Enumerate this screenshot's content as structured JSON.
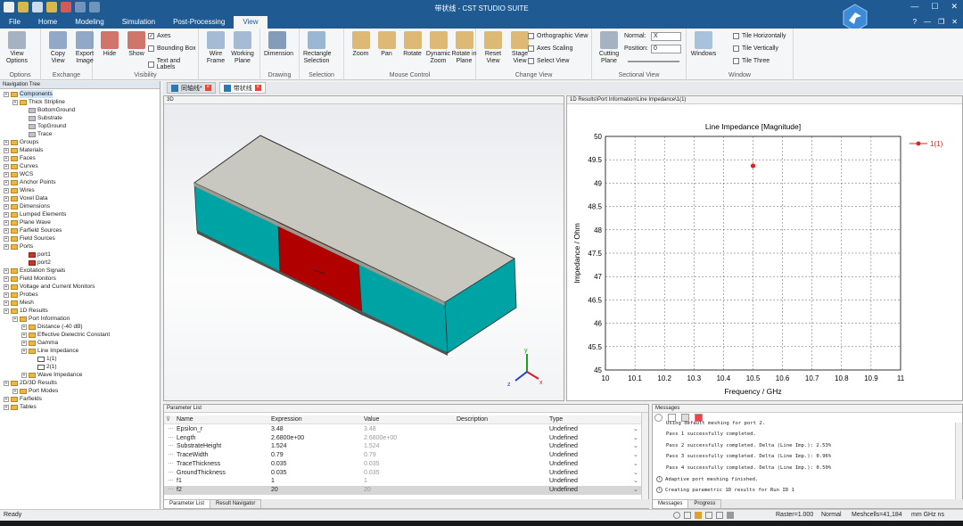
{
  "window": {
    "title": "带状线 - CST STUDIO SUITE"
  },
  "menu": {
    "tabs": [
      "File",
      "Home",
      "Modeling",
      "Simulation",
      "Post-Processing",
      "View"
    ],
    "active": "View"
  },
  "ribbon": {
    "groups": [
      {
        "label": "Options",
        "buttons": [
          "View\nOptions"
        ]
      },
      {
        "label": "Exchange",
        "buttons": [
          "Copy\nView",
          "Export\nImage"
        ]
      },
      {
        "label": "Visibility",
        "buttons": [
          "Hide",
          "Show"
        ],
        "checks": [
          "Axes",
          "Bounding Box",
          "Text and Labels"
        ]
      },
      {
        "label": "",
        "buttons": [
          "Wire\nFrame",
          "Working\nPlane"
        ]
      },
      {
        "label": "Drawing",
        "buttons": [
          "Dimension"
        ]
      },
      {
        "label": "Selection",
        "buttons": [
          "Rectangle\nSelection"
        ]
      },
      {
        "label": "Mouse Control",
        "buttons": [
          "Zoom",
          "Pan",
          "Rotate",
          "Dynamic\nZoom",
          "Rotate in\nPlane"
        ]
      },
      {
        "label": "Change View",
        "buttons": [
          "Reset\nView",
          "Stage\nView"
        ],
        "checks": [
          "Orthographic View",
          "Axes Scaling",
          "Select View"
        ]
      },
      {
        "label": "Sectional View",
        "buttons": [
          "Cutting\nPlane"
        ],
        "fields": {
          "normal_label": "Normal:",
          "normal_value": "X",
          "position_label": "Position:",
          "position_value": "0"
        }
      },
      {
        "label": "Window",
        "buttons": [
          "Windows"
        ],
        "checks": [
          "Tile Horizontally",
          "Tile Vertically",
          "Tile Three"
        ]
      }
    ]
  },
  "nav": {
    "header": "Navigation Tree",
    "items": [
      {
        "label": "Components",
        "level": 0,
        "icon": "folder",
        "selected": true
      },
      {
        "label": "Thick Stripline",
        "level": 1,
        "icon": "folder"
      },
      {
        "label": "BottomGround",
        "level": 2,
        "icon": "solid"
      },
      {
        "label": "Substrate",
        "level": 2,
        "icon": "solid"
      },
      {
        "label": "TopGround",
        "level": 2,
        "icon": "solid"
      },
      {
        "label": "Trace",
        "level": 2,
        "icon": "solid"
      },
      {
        "label": "Groups",
        "level": 0,
        "icon": "folder"
      },
      {
        "label": "Materials",
        "level": 0,
        "icon": "folder"
      },
      {
        "label": "Faces",
        "level": 0,
        "icon": "folder"
      },
      {
        "label": "Curves",
        "level": 0,
        "icon": "folder"
      },
      {
        "label": "WCS",
        "level": 0,
        "icon": "folder"
      },
      {
        "label": "Anchor Points",
        "level": 0,
        "icon": "folder"
      },
      {
        "label": "Wires",
        "level": 0,
        "icon": "folder"
      },
      {
        "label": "Voxel Data",
        "level": 0,
        "icon": "folder"
      },
      {
        "label": "Dimensions",
        "level": 0,
        "icon": "folder"
      },
      {
        "label": "Lumped Elements",
        "level": 0,
        "icon": "folder"
      },
      {
        "label": "Plane Wave",
        "level": 0,
        "icon": "folder"
      },
      {
        "label": "Farfield Sources",
        "level": 0,
        "icon": "folder"
      },
      {
        "label": "Field Sources",
        "level": 0,
        "icon": "folder"
      },
      {
        "label": "Ports",
        "level": 0,
        "icon": "folder"
      },
      {
        "label": "port1",
        "level": 2,
        "icon": "port"
      },
      {
        "label": "port2",
        "level": 2,
        "icon": "port"
      },
      {
        "label": "Excitation Signals",
        "level": 0,
        "icon": "folder"
      },
      {
        "label": "Field Monitors",
        "level": 0,
        "icon": "folder"
      },
      {
        "label": "Voltage and Current Monitors",
        "level": 0,
        "icon": "folder"
      },
      {
        "label": "Probes",
        "level": 0,
        "icon": "folder"
      },
      {
        "label": "Mesh",
        "level": 0,
        "icon": "folder"
      },
      {
        "label": "1D Results",
        "level": 0,
        "icon": "folder"
      },
      {
        "label": "Port Information",
        "level": 1,
        "icon": "folder"
      },
      {
        "label": "Distance (-40 dB)",
        "level": 2,
        "icon": "folder"
      },
      {
        "label": "Effective Dielectric Constant",
        "level": 2,
        "icon": "folder"
      },
      {
        "label": "Gamma",
        "level": 2,
        "icon": "folder"
      },
      {
        "label": "Line Impedance",
        "level": 2,
        "icon": "folder"
      },
      {
        "label": "1(1)",
        "level": 3,
        "icon": "plot"
      },
      {
        "label": "2(1)",
        "level": 3,
        "icon": "plot"
      },
      {
        "label": "Wave Impedance",
        "level": 2,
        "icon": "folder"
      },
      {
        "label": "2D/3D Results",
        "level": 0,
        "icon": "folder"
      },
      {
        "label": "Port Modes",
        "level": 1,
        "icon": "folder"
      },
      {
        "label": "Farfields",
        "level": 0,
        "icon": "folder"
      },
      {
        "label": "Tables",
        "level": 0,
        "icon": "folder"
      }
    ]
  },
  "doctabs": [
    "同轴线*",
    "带状线"
  ],
  "view3d": {
    "header": "3D",
    "axis_labels": [
      "x",
      "y",
      "z"
    ]
  },
  "plot": {
    "header": "1D Results\\Port Information\\Line Impedance\\1(1)"
  },
  "chart_data": {
    "type": "scatter",
    "title": "Line Impedance [Magnitude]",
    "xlabel": "Frequency / GHz",
    "ylabel": "Impedance / Ohm",
    "xlim": [
      10,
      11
    ],
    "ylim": [
      45,
      50
    ],
    "xticks": [
      "10",
      "10.1",
      "10.2",
      "10.3",
      "10.4",
      "10.5",
      "10.6",
      "10.7",
      "10.8",
      "10.9",
      "11"
    ],
    "yticks": [
      "45",
      "45.5",
      "46",
      "46.5",
      "47",
      "47.5",
      "48",
      "48.5",
      "49",
      "49.5",
      "50"
    ],
    "grid": true,
    "legend_position": "top-right",
    "series": [
      {
        "name": "1(1)",
        "color": "#e02020",
        "points": [
          {
            "x": 10.5,
            "y": 49.37
          }
        ]
      }
    ]
  },
  "params": {
    "header": "Parameter List",
    "columns": [
      "Name",
      "Expression",
      "Value",
      "Description",
      "Type"
    ],
    "rows": [
      [
        "Epsilon_r",
        "3.48",
        "3.48",
        "",
        "Undefined"
      ],
      [
        "Length",
        "2.6800e+00",
        "2.6800e+00",
        "",
        "Undefined"
      ],
      [
        "SubstrateHeight",
        "1.524",
        "1.524",
        "",
        "Undefined"
      ],
      [
        "TraceWidth",
        "0.79",
        "0.79",
        "",
        "Undefined"
      ],
      [
        "TraceThickness",
        "0.035",
        "0.035",
        "",
        "Undefined"
      ],
      [
        "GroundThickness",
        "0.035",
        "0.035",
        "",
        "Undefined"
      ],
      [
        "f1",
        "1",
        "1",
        "",
        "Undefined"
      ],
      [
        "f2",
        "20",
        "20",
        "",
        "Undefined"
      ]
    ],
    "tabs": [
      "Parameter List",
      "Result Navigator"
    ]
  },
  "messages": {
    "header": "Messages",
    "lines": [
      "Using default meshing for port 2.",
      "Pass 1 successfully completed.",
      "Pass 2 successfully completed. Delta (Line Imp.): 2.53%",
      "Pass 3 successfully completed. Delta (Line Imp.): 0.96%",
      "Pass 4 successfully completed. Delta (Line Imp.): 0.50%",
      "Adaptive port meshing finished.",
      "Creating parametric 1D results for Run ID 1"
    ],
    "tabs": [
      "Messages",
      "Progress"
    ]
  },
  "status": {
    "left": "Ready",
    "raster": "Raster=1.000",
    "mode": "Normal",
    "meshcells": "Meshcells=41,184",
    "units": "mm  GHz  ns"
  },
  "colors": {
    "title_bar": "#1f5a93",
    "substrate": "#00a3a3",
    "trace": "#b00000",
    "ground": "#c8c8c0"
  }
}
